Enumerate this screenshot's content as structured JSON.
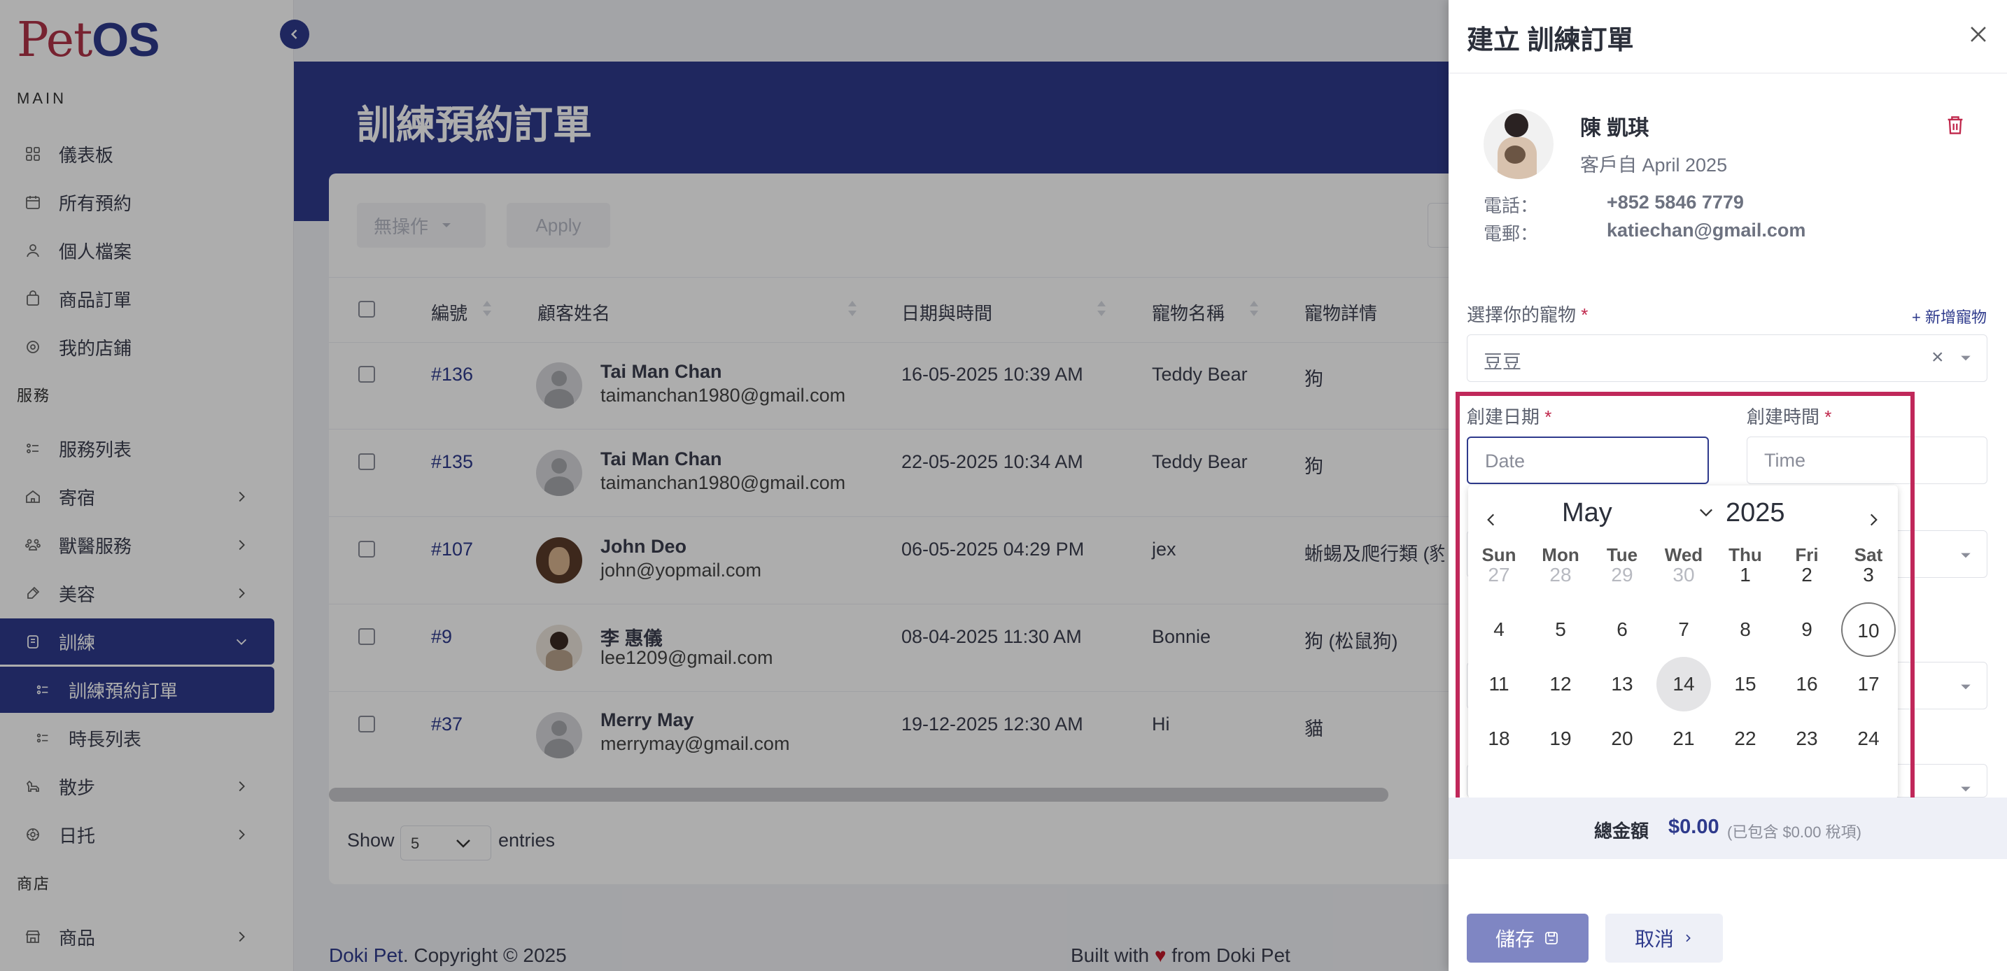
{
  "app": {
    "logo_pet": "Pet",
    "logo_os": "OS"
  },
  "sidebar": {
    "main_label": "MAIN",
    "services_label": "服務",
    "shop_label": "商店",
    "items": [
      {
        "label": "儀表板"
      },
      {
        "label": "所有預約"
      },
      {
        "label": "個人檔案"
      },
      {
        "label": "商品訂單"
      },
      {
        "label": "我的店鋪"
      },
      {
        "label": "服務列表"
      },
      {
        "label": "寄宿"
      },
      {
        "label": "獸醫服務"
      },
      {
        "label": "美容"
      },
      {
        "label": "訓練"
      },
      {
        "label": "訓練預約訂單"
      },
      {
        "label": "時長列表"
      },
      {
        "label": "散步"
      },
      {
        "label": "日托"
      },
      {
        "label": "商品"
      }
    ]
  },
  "main": {
    "page_title": "訓練預約訂單",
    "bulk_action": "無操作",
    "apply": "Apply",
    "columns": [
      "編號",
      "顧客姓名",
      "日期與時間",
      "寵物名稱",
      "寵物詳情"
    ],
    "rows": [
      {
        "id": "#136",
        "name": "Tai Man Chan",
        "email": "taimanchan1980@gmail.com",
        "datetime": "16-05-2025 10:39 AM",
        "pet": "Teddy Bear",
        "detail": "狗"
      },
      {
        "id": "#135",
        "name": "Tai Man Chan",
        "email": "taimanchan1980@gmail.com",
        "datetime": "22-05-2025 10:34 AM",
        "pet": "Teddy Bear",
        "detail": "狗"
      },
      {
        "id": "#107",
        "name": "John Deo",
        "email": "john@yopmail.com",
        "datetime": "06-05-2025 04:29 PM",
        "pet": "jex",
        "detail": "蜥蜴及爬行類 (豹紋"
      },
      {
        "id": "#9",
        "name": "李 惠儀",
        "email": "lee1209@gmail.com",
        "datetime": "08-04-2025 11:30 AM",
        "pet": "Bonnie",
        "detail": "狗 (松鼠狗)"
      },
      {
        "id": "#37",
        "name": "Merry May",
        "email": "merrymay@gmail.com",
        "datetime": "19-12-2025 12:30 AM",
        "pet": "Hi",
        "detail": "貓"
      }
    ],
    "show_label": "Show",
    "entries_value": "5",
    "entries_label": "entries"
  },
  "footer": {
    "brand": "Doki Pet",
    "copyright": ". Copyright © 2025",
    "built_with": "Built with",
    "heart": "♥",
    "from": "from Doki Pet"
  },
  "drawer": {
    "title": "建立 訓練訂單",
    "customer_name": "陳 凱琪",
    "customer_since": "客戶自 April 2025",
    "phone_label": "電話：",
    "phone": "+852 5846 7779",
    "email_label": "電郵：",
    "email": "katiechan@gmail.com",
    "pet_label": "選擇你的寵物",
    "required": "*",
    "add_pet": "+ 新增寵物",
    "pet_value": "豆豆",
    "clear": "×",
    "date_label": "創建日期",
    "date_placeholder": "Date",
    "time_label": "創建時間",
    "time_placeholder": "Time",
    "total_label": "總金額",
    "total_value": "$0.00",
    "total_tax": "(已包含 $0.00 稅項)",
    "save": "儲存",
    "cancel": "取消"
  },
  "calendar": {
    "month": "May",
    "year": "2025",
    "weekdays": [
      "Sun",
      "Mon",
      "Tue",
      "Wed",
      "Thu",
      "Fri",
      "Sat"
    ],
    "weeks": [
      [
        "27",
        "28",
        "29",
        "30",
        "1",
        "2",
        "3"
      ],
      [
        "4",
        "5",
        "6",
        "7",
        "8",
        "9",
        "10"
      ],
      [
        "11",
        "12",
        "13",
        "14",
        "15",
        "16",
        "17"
      ],
      [
        "18",
        "19",
        "20",
        "21",
        "22",
        "23",
        "24"
      ]
    ],
    "today": "10",
    "selected": "14"
  },
  "colors": {
    "primary": "#2e3a8c",
    "accent": "#c0285a",
    "logo_red": "#b03348"
  }
}
